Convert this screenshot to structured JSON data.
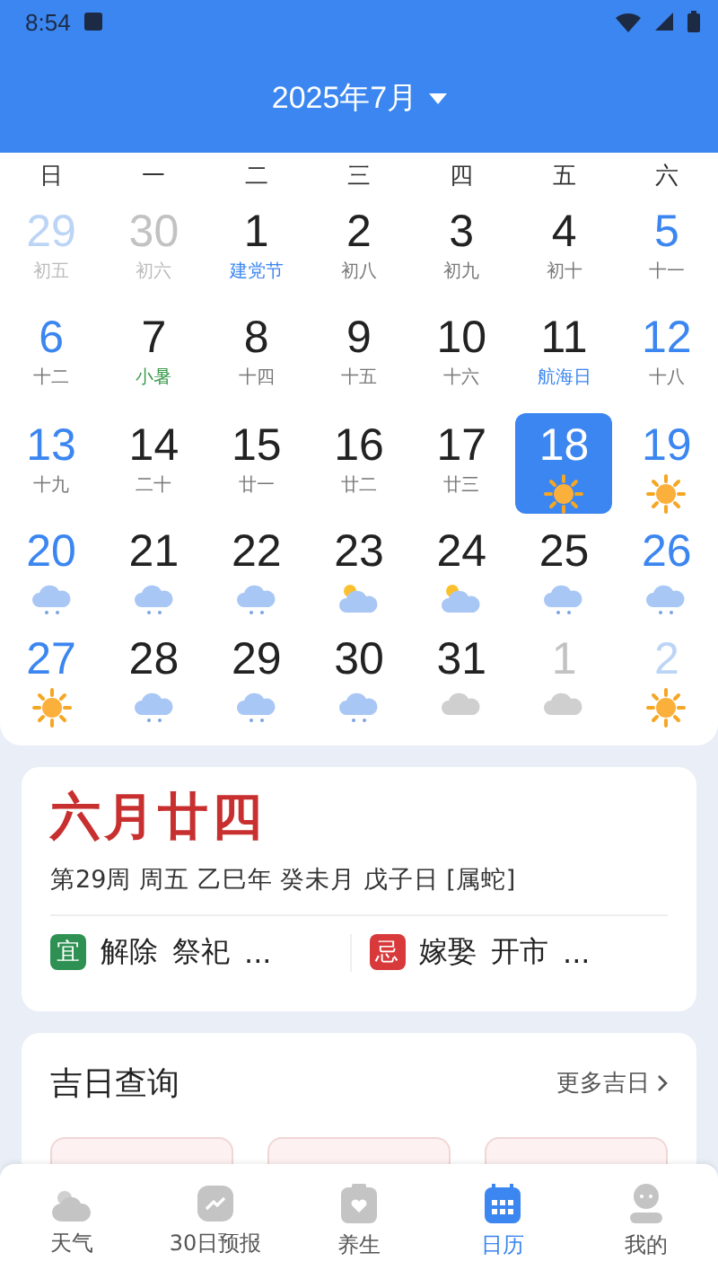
{
  "status_bar": {
    "time": "8:54"
  },
  "header": {
    "title": "2025年7月"
  },
  "weekdays": [
    "日",
    "一",
    "二",
    "三",
    "四",
    "五",
    "六"
  ],
  "days": [
    {
      "day": "29",
      "in_month": false,
      "weekend": true,
      "selected": false,
      "sub": "初五",
      "kind": "lunar"
    },
    {
      "day": "30",
      "in_month": false,
      "weekend": false,
      "selected": false,
      "sub": "初六",
      "kind": "lunar"
    },
    {
      "day": "1",
      "in_month": true,
      "weekend": false,
      "selected": false,
      "sub": "建党节",
      "kind": "festival"
    },
    {
      "day": "2",
      "in_month": true,
      "weekend": false,
      "selected": false,
      "sub": "初八",
      "kind": "lunar"
    },
    {
      "day": "3",
      "in_month": true,
      "weekend": false,
      "selected": false,
      "sub": "初九",
      "kind": "lunar"
    },
    {
      "day": "4",
      "in_month": true,
      "weekend": false,
      "selected": false,
      "sub": "初十",
      "kind": "lunar"
    },
    {
      "day": "5",
      "in_month": true,
      "weekend": true,
      "selected": false,
      "sub": "十一",
      "kind": "lunar"
    },
    {
      "day": "6",
      "in_month": true,
      "weekend": true,
      "selected": false,
      "sub": "十二",
      "kind": "lunar"
    },
    {
      "day": "7",
      "in_month": true,
      "weekend": false,
      "selected": false,
      "sub": "小暑",
      "kind": "term"
    },
    {
      "day": "8",
      "in_month": true,
      "weekend": false,
      "selected": false,
      "sub": "十四",
      "kind": "lunar"
    },
    {
      "day": "9",
      "in_month": true,
      "weekend": false,
      "selected": false,
      "sub": "十五",
      "kind": "lunar"
    },
    {
      "day": "10",
      "in_month": true,
      "weekend": false,
      "selected": false,
      "sub": "十六",
      "kind": "lunar"
    },
    {
      "day": "11",
      "in_month": true,
      "weekend": false,
      "selected": false,
      "sub": "航海日",
      "kind": "festival"
    },
    {
      "day": "12",
      "in_month": true,
      "weekend": true,
      "selected": false,
      "sub": "十八",
      "kind": "lunar"
    },
    {
      "day": "13",
      "in_month": true,
      "weekend": true,
      "selected": false,
      "sub": "十九",
      "kind": "lunar"
    },
    {
      "day": "14",
      "in_month": true,
      "weekend": false,
      "selected": false,
      "sub": "二十",
      "kind": "lunar"
    },
    {
      "day": "15",
      "in_month": true,
      "weekend": false,
      "selected": false,
      "sub": "廿一",
      "kind": "lunar"
    },
    {
      "day": "16",
      "in_month": true,
      "weekend": false,
      "selected": false,
      "sub": "廿二",
      "kind": "lunar"
    },
    {
      "day": "17",
      "in_month": true,
      "weekend": false,
      "selected": false,
      "sub": "廿三",
      "kind": "lunar"
    },
    {
      "day": "18",
      "in_month": true,
      "weekend": false,
      "selected": true,
      "kind": "sunny"
    },
    {
      "day": "19",
      "in_month": true,
      "weekend": true,
      "selected": false,
      "kind": "sunny"
    },
    {
      "day": "20",
      "in_month": true,
      "weekend": true,
      "selected": false,
      "kind": "rain"
    },
    {
      "day": "21",
      "in_month": true,
      "weekend": false,
      "selected": false,
      "kind": "rain"
    },
    {
      "day": "22",
      "in_month": true,
      "weekend": false,
      "selected": false,
      "kind": "rain"
    },
    {
      "day": "23",
      "in_month": true,
      "weekend": false,
      "selected": false,
      "kind": "partly"
    },
    {
      "day": "24",
      "in_month": true,
      "weekend": false,
      "selected": false,
      "kind": "partly"
    },
    {
      "day": "25",
      "in_month": true,
      "weekend": false,
      "selected": false,
      "kind": "rain"
    },
    {
      "day": "26",
      "in_month": true,
      "weekend": true,
      "selected": false,
      "kind": "rain"
    },
    {
      "day": "27",
      "in_month": true,
      "weekend": true,
      "selected": false,
      "kind": "sunny"
    },
    {
      "day": "28",
      "in_month": true,
      "weekend": false,
      "selected": false,
      "kind": "rain"
    },
    {
      "day": "29",
      "in_month": true,
      "weekend": false,
      "selected": false,
      "kind": "rain"
    },
    {
      "day": "30",
      "in_month": true,
      "weekend": false,
      "selected": false,
      "kind": "rain"
    },
    {
      "day": "31",
      "in_month": true,
      "weekend": false,
      "selected": false,
      "kind": "cloudy"
    },
    {
      "day": "1",
      "in_month": false,
      "weekend": false,
      "selected": false,
      "kind": "cloudy"
    },
    {
      "day": "2",
      "in_month": false,
      "weekend": true,
      "selected": false,
      "kind": "sunny"
    }
  ],
  "almanac": {
    "lunar_date": "六月廿四",
    "details": "第29周 周五 乙巳年 癸未月 戊子日 [属蛇]",
    "columns": [
      {
        "kind": "good",
        "badge": "宜",
        "items": [
          "解除",
          "祭祀"
        ],
        "more": "..."
      },
      {
        "kind": "bad",
        "badge": "忌",
        "items": [
          "嫁娶",
          "开市"
        ],
        "more": "..."
      }
    ]
  },
  "lucky_days": {
    "title": "吉日查询",
    "more": "更多吉日"
  },
  "nav": [
    {
      "label": "天气",
      "kind": "weather",
      "selected": false
    },
    {
      "label": "30日预报",
      "kind": "chart",
      "selected": false
    },
    {
      "label": "养生",
      "kind": "health",
      "selected": false
    },
    {
      "label": "日历",
      "kind": "calendar",
      "selected": true
    },
    {
      "label": "我的",
      "kind": "person",
      "selected": false
    }
  ]
}
